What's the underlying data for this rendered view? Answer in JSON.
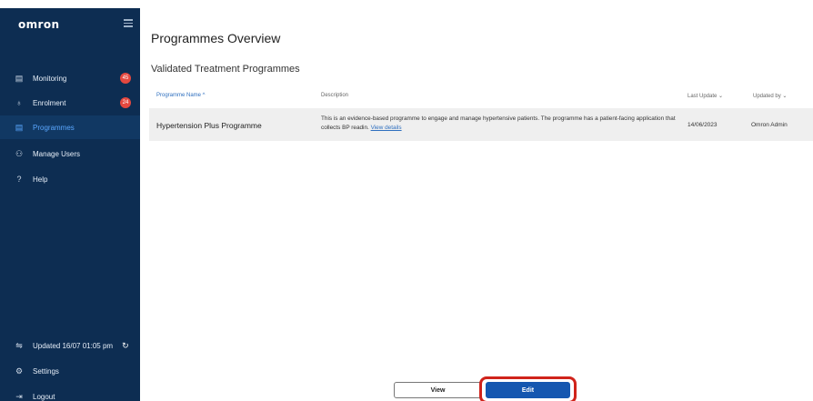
{
  "brand": {
    "name": "omron"
  },
  "sidebar": {
    "items": [
      {
        "label": "Monitoring",
        "icon": "monitoring-icon",
        "glyph": "▤",
        "badge": "45"
      },
      {
        "label": "Enrolment",
        "icon": "enrolment-icon",
        "glyph": "♁",
        "badge": "24"
      },
      {
        "label": "Programmes",
        "icon": "programmes-icon",
        "glyph": "▤"
      },
      {
        "label": "Manage Users",
        "icon": "manage-users-icon",
        "glyph": "⚇"
      },
      {
        "label": "Help",
        "icon": "help-icon",
        "glyph": "?"
      }
    ],
    "sync_label": "Updated 16/07 01:05 pm",
    "settings_label": "Settings",
    "logout_label": "Logout"
  },
  "main": {
    "page_title": "Programmes Overview",
    "section_title": "Validated Treatment Programmes",
    "table": {
      "headers": {
        "name": "Programme Name ^",
        "description": "Description",
        "last_update": "Last Update ⌄",
        "updated_by": "Updated by ⌄"
      },
      "rows": [
        {
          "name": "Hypertension Plus Programme",
          "description": "This is an evidence-based programme to engage and manage hypertensive patients. The programme has a patient-facing application that collects BP readin.",
          "link": "View details",
          "last_update": "14/06/2023",
          "updated_by": "Omron Admin"
        }
      ]
    },
    "buttons": {
      "view": "View",
      "edit": "Edit"
    }
  },
  "colors": {
    "sidebar_bg": "#0d2d52",
    "active_item": "#5aa7ff",
    "badge": "#e4483f",
    "primary_button": "#1557b0",
    "highlight": "#d0231b"
  }
}
